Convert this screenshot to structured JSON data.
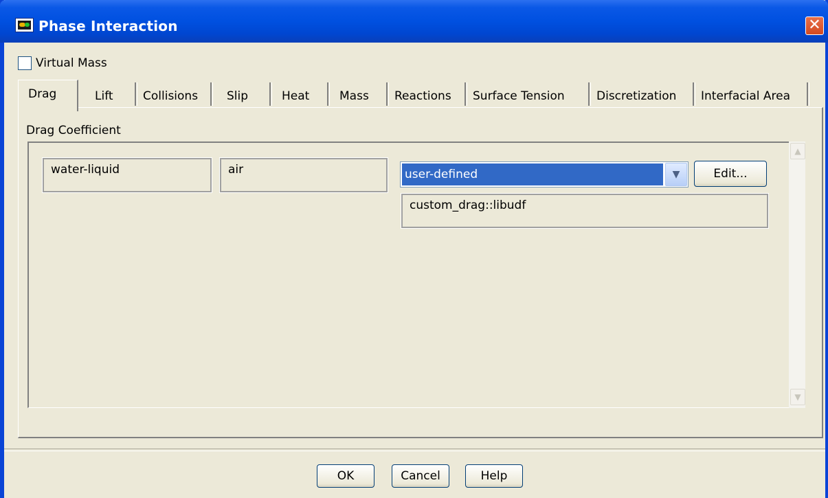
{
  "window": {
    "title": "Phase Interaction",
    "close_glyph": "✕"
  },
  "options": {
    "virtual_mass_label": "Virtual Mass",
    "virtual_mass_checked": false
  },
  "tabs": [
    {
      "label": "Drag",
      "active": true
    },
    {
      "label": "Lift"
    },
    {
      "label": "Collisions"
    },
    {
      "label": "Slip"
    },
    {
      "label": "Heat"
    },
    {
      "label": "Mass"
    },
    {
      "label": "Reactions"
    },
    {
      "label": "Surface Tension"
    },
    {
      "label": "Discretization"
    },
    {
      "label": "Interfacial Area"
    }
  ],
  "drag": {
    "group_label": "Drag Coefficient",
    "phase_1": "water-liquid",
    "phase_2": "air",
    "method": "user-defined",
    "edit_label": "Edit...",
    "udf": "custom_drag::libudf"
  },
  "footer": {
    "ok_label": "OK",
    "cancel_label": "Cancel",
    "help_label": "Help"
  },
  "icons": {
    "app": "fluent-app-icon",
    "close": "close-icon",
    "dropdown": "chevron-down-icon",
    "scroll_up": "scroll-up-icon",
    "scroll_down": "scroll-down-icon"
  }
}
